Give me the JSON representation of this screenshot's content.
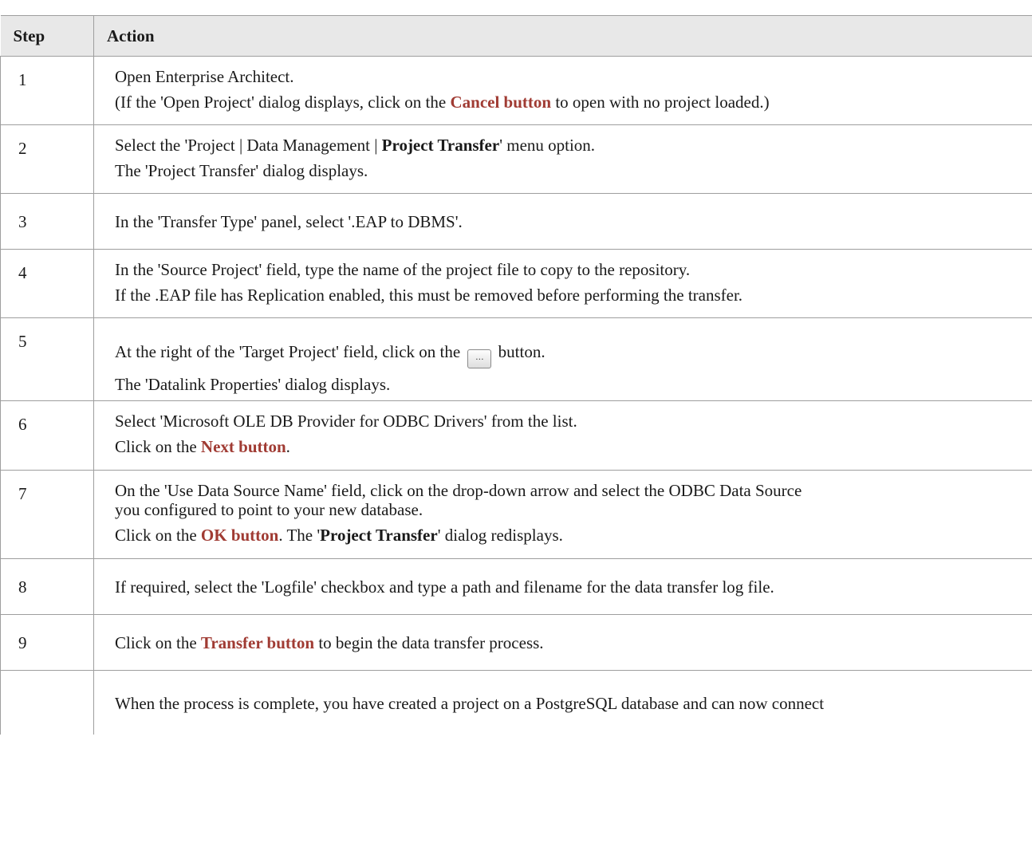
{
  "table": {
    "headers": {
      "step": "Step",
      "action": "Action"
    },
    "rows": [
      {
        "step": "1",
        "l1": "Open Enterprise Architect.",
        "l2a": "(If the 'Open Project' dialog displays, click on the ",
        "l2b": "Cancel button",
        "l2c": " to open with no project loaded.)"
      },
      {
        "step": "2",
        "l1a": "Select the 'Project | Data Management | ",
        "l1b": "Project Transfer",
        "l1c": "' menu option.",
        "l2": "The 'Project Transfer' dialog displays."
      },
      {
        "step": "3",
        "l1": "In the 'Transfer Type' panel, select '.EAP to DBMS'."
      },
      {
        "step": "4",
        "l1": "In the 'Source Project' field, type the name of the project file to copy to the repository.",
        "l2": "If the .EAP file has Replication enabled, this must be removed before performing the transfer."
      },
      {
        "step": "5",
        "l1a": "At the right of the 'Target Project' field, click on the ",
        "btn": "...",
        "l1b": " button.",
        "l2": "The 'Datalink Properties' dialog displays."
      },
      {
        "step": "6",
        "l1": "Select 'Microsoft OLE DB Provider for ODBC Drivers' from the list.",
        "l2a": "Click on the ",
        "l2b": "Next button",
        "l2c": "."
      },
      {
        "step": "7",
        "l1": "On the 'Use Data Source Name' field, click on the drop-down arrow and select the ODBC Data Source",
        "l2": "you configured to point to your new database.",
        "l3a": "Click on the ",
        "l3b": "OK button",
        "l3c": ". The '",
        "l3d": "Project Transfer",
        "l3e": "' dialog redisplays."
      },
      {
        "step": "8",
        "l1": "If required, select the 'Logfile' checkbox and type a path and filename for the data transfer log file."
      },
      {
        "step": "9",
        "l1a": "Click on the ",
        "l1b": "Transfer button",
        "l1c": " to begin the data transfer process."
      },
      {
        "step": "",
        "l1": "When the process is complete, you have created a project on a PostgreSQL database and can now connect"
      }
    ]
  }
}
